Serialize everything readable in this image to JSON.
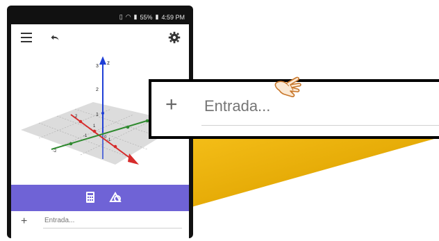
{
  "status_bar": {
    "battery": "55%",
    "time": "4:59 PM",
    "icons": [
      "vibrate-icon",
      "wifi-icon",
      "signal-icon",
      "battery-icon"
    ]
  },
  "app_bar": {
    "icons": [
      "menu-icon",
      "undo-icon",
      "settings-icon"
    ]
  },
  "graph": {
    "type": "3d-axes",
    "z_ticks": [
      "3",
      "2",
      "1"
    ],
    "z_label": "z",
    "x_ticks": [
      "-1",
      "1",
      "2"
    ],
    "y_ticks": [
      "2",
      "-1",
      "-2"
    ]
  },
  "view_tabs": {
    "icons": [
      "calculator-icon",
      "tools-icon"
    ],
    "active": "calculator-icon"
  },
  "input_bar": {
    "plus": "+",
    "placeholder": "Entrada..."
  },
  "zoom_callout": {
    "plus": "+",
    "placeholder": "Entrada..."
  },
  "colors": {
    "purple_bar": "#6f63d6",
    "wedge_yellow": "#f2b705",
    "axis_blue": "#1f3fd6",
    "axis_red": "#d62b2b",
    "axis_green": "#2f8a2f",
    "cursor_orange": "#c8762a"
  },
  "cursor": "hand-pointer-icon"
}
